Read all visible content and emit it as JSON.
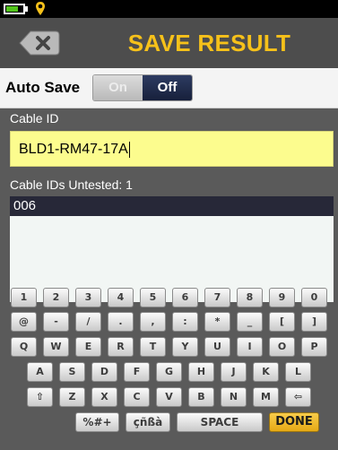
{
  "status": {
    "battery_level": 0.72,
    "icons": [
      "battery-icon",
      "location-pin-icon"
    ],
    "battery_color": "#52c41a"
  },
  "header": {
    "title": "SAVE RESULT",
    "back_icon": "backspace-arrow-icon",
    "title_color": "#f6c11a"
  },
  "auto_save": {
    "label": "Auto Save",
    "on_label": "On",
    "off_label": "Off",
    "selected": "Off"
  },
  "cable_id": {
    "label": "Cable ID",
    "value": "BLD1-RM47-17A"
  },
  "untested": {
    "label": "Cable IDs Untested: 1",
    "items": [
      "006"
    ]
  },
  "keyboard": {
    "rows": [
      [
        "1",
        "2",
        "3",
        "4",
        "5",
        "6",
        "7",
        "8",
        "9",
        "0"
      ],
      [
        "@",
        "-",
        "/",
        ".",
        ",",
        ":",
        "*",
        "_",
        "[",
        "]"
      ],
      [
        "Q",
        "W",
        "E",
        "R",
        "T",
        "Y",
        "U",
        "I",
        "O",
        "P"
      ],
      [
        "A",
        "S",
        "D",
        "F",
        "G",
        "H",
        "J",
        "K",
        "L"
      ],
      [
        "⇧",
        "Z",
        "X",
        "C",
        "V",
        "B",
        "N",
        "M",
        "⇦"
      ],
      [
        "%#+",
        "çñßà",
        "SPACE",
        "DONE"
      ]
    ],
    "shift_icon": "shift-arrow-icon",
    "backspace_icon": "backspace-arrow-icon"
  }
}
